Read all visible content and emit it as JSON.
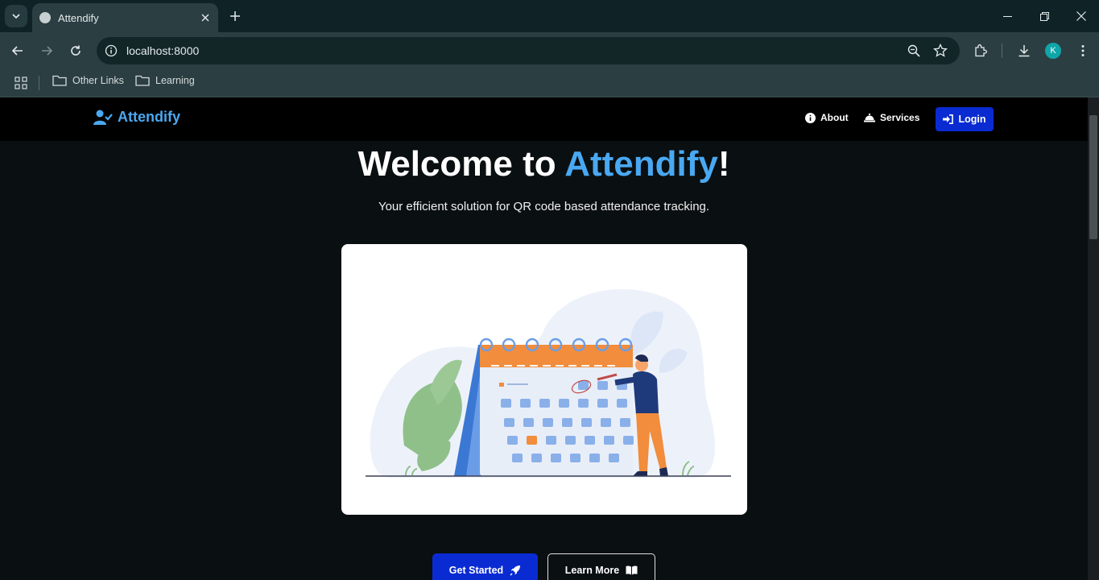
{
  "browser": {
    "tab_title": "Attendify",
    "url": "localhost:8000",
    "profile_initial": "K",
    "bookmarks": [
      {
        "label": "Other Links",
        "icon": "folder-icon"
      },
      {
        "label": "Learning",
        "icon": "folder-icon"
      }
    ]
  },
  "navbar": {
    "brand": "Attendify",
    "links": [
      {
        "label": "About",
        "icon": "info-icon"
      },
      {
        "label": "Services",
        "icon": "bell-concierge-icon"
      }
    ],
    "login_label": "Login"
  },
  "hero": {
    "title_prefix": "Welcome to ",
    "title_accent": "Attendify",
    "title_suffix": "!",
    "subtitle": "Your efficient solution for QR code based attendance tracking.",
    "illustration": "calendar-person-illustration"
  },
  "actions": {
    "get_started": "Get Started",
    "learn_more": "Learn More"
  },
  "colors": {
    "accent": "#4aa8f2",
    "primary_button": "#0a2bd2",
    "page_bg": "#0a0f11"
  }
}
